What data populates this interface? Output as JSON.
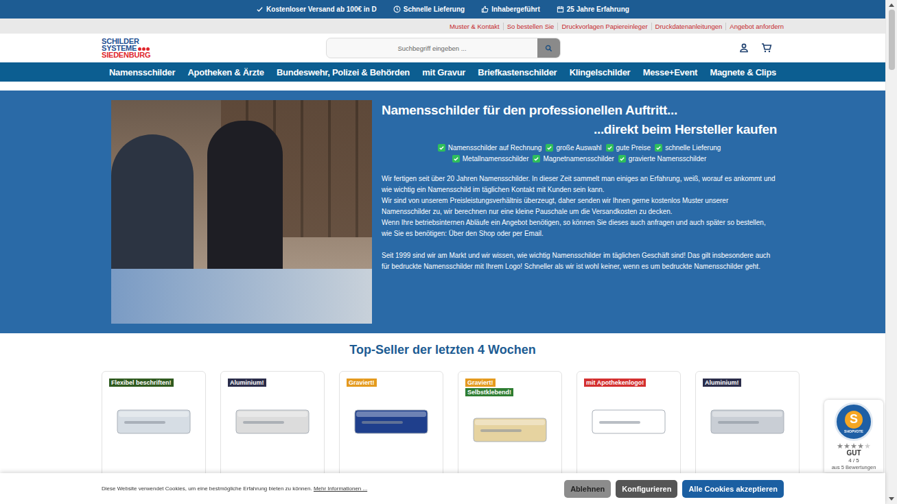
{
  "topbar": {
    "items": [
      "Kostenloser Versand ab 100€ in D",
      "Schnelle Lieferung",
      "Inhabergeführt",
      "25 Jahre Erfahrung"
    ]
  },
  "service_links": [
    "Muster & Kontakt",
    "So bestellen Sie",
    "Druckvorlagen Papiereinleger",
    "Druckdatenanleitungen",
    "Angebot anfordern"
  ],
  "logo": {
    "lines": [
      "SCHILDER",
      "SYSTEME",
      "SIEDENBURG"
    ]
  },
  "search": {
    "placeholder": "Suchbegriff eingeben ..."
  },
  "nav": [
    "Namensschilder",
    "Apotheken & Ärzte",
    "Bundeswehr, Polizei & Behörden",
    "mit Gravur",
    "Briefkastenschilder",
    "Klingelschilder",
    "Messe+Event",
    "Magnete & Clips"
  ],
  "hero": {
    "title": "Namensschilder für den professionellen Auftritt...",
    "subtitle": "...direkt beim Hersteller kaufen",
    "feature_rows": [
      [
        {
          "label": "Namensschilder auf Rechnung",
          "checked": true
        },
        {
          "label": "große Auswahl",
          "checked": true
        },
        {
          "label": "gute Preise",
          "checked": true
        },
        {
          "label": "schnelle Lieferung",
          "checked": true
        }
      ],
      [
        {
          "label": "Metallnamensschilder",
          "checked": true
        },
        {
          "label": "Magnetnamensschilder",
          "checked": true
        },
        {
          "label": "gravierte Namensschilder",
          "checked": true
        }
      ]
    ],
    "paragraphs": [
      "Wir fertigen seit über 20 Jahren Namensschilder. In dieser Zeit sammelt man einiges an Erfahrung, weiß, worauf es ankommt und wie wichtig ein Namensschild im täglichen Kontakt mit Kunden sein kann.",
      "Wir sind von unserem Preisleistungsverhältnis überzeugt, daher senden wir Ihnen gerne kostenlos Muster unserer Namensschilder zu, wir berechnen nur eine kleine Pauschale um die Versandkosten zu decken.",
      "Wenn Ihre betriebsinternen Abläufe ein Angebot benötigen, so können Sie dieses auch anfragen und auch später so bestellen, wie Sie es benötigen: Über den Shop oder per Email."
    ],
    "closing": "Seit 1999 sind wir am Markt und wir wissen, wie wichtig Namensschilder im täglichen Geschäft sind! Das gilt insbesondere auch für bedruckte Namensschilder mit Ihrem Logo! Schneller als wir ist wohl keiner, wenn es um bedruckte Namensschilder geht."
  },
  "topseller": {
    "title": "Top-Seller der letzten 4 Wochen",
    "products": [
      {
        "badges": [
          {
            "label": "Flexibel beschriften!",
            "color": "#2f5a1f"
          }
        ]
      },
      {
        "badges": [
          {
            "label": "Aluminium!",
            "color": "#2b2d4a"
          }
        ]
      },
      {
        "badges": [
          {
            "label": "Graviert!",
            "color": "#e49a1e"
          }
        ]
      },
      {
        "badges": [
          {
            "label": "Graviert!",
            "color": "#e49a1e"
          },
          {
            "label": "Selbstklebend!",
            "color": "#2e7d32"
          }
        ]
      },
      {
        "badges": [
          {
            "label": "mit Apothekenlogo!",
            "color": "#d32f2f"
          }
        ]
      },
      {
        "badges": [
          {
            "label": "Aluminium!",
            "color": "#2b2d4a"
          }
        ]
      }
    ]
  },
  "cookie": {
    "text": "Diese Website verwendet Cookies, um eine bestmögliche Erfahrung bieten zu können.",
    "link": "Mehr Informationen ...",
    "buttons": [
      {
        "label": "Ablehnen",
        "kind": "decline"
      },
      {
        "label": "Konfigurieren",
        "kind": "configure"
      },
      {
        "label": "Alle Cookies akzeptieren",
        "kind": "accept"
      }
    ]
  },
  "rating": {
    "logo": "S",
    "brand": "SHOPVOTE",
    "stars": 4,
    "grade": "GUT",
    "score": "4 / 5",
    "count": "aus 5 Bewertungen"
  }
}
